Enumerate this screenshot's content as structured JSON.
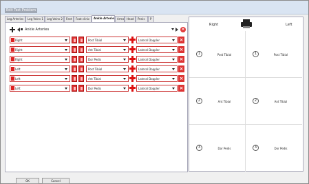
{
  "window": {
    "title": "Edit Test Problem"
  },
  "tabs": [
    {
      "label": "Leg Arteries",
      "active": false
    },
    {
      "label": "Leg Veins 1",
      "active": false
    },
    {
      "label": "Leg Veins 2",
      "active": false
    },
    {
      "label": "Feet",
      "active": false
    },
    {
      "label": "Foot clinic",
      "active": false
    },
    {
      "label": "Ankle Arteries",
      "active": true
    },
    {
      "label": "Arms",
      "active": false
    },
    {
      "label": "Head",
      "active": false
    },
    {
      "label": "Penis",
      "active": false
    },
    {
      "label": "P",
      "active": false
    }
  ],
  "artery_selector": {
    "value": "Ankle Arteries"
  },
  "rows": [
    {
      "side": "Right",
      "vessel": "Post Tibial",
      "method": "Lateral Doppler"
    },
    {
      "side": "Right",
      "vessel": "Ant Tibial",
      "method": "Lateral Doppler"
    },
    {
      "side": "Right",
      "vessel": "Dor Pedis",
      "method": "Lateral Doppler"
    },
    {
      "side": "Left",
      "vessel": "Post Tibial",
      "method": "Lateral Doppler"
    },
    {
      "side": "Left",
      "vessel": "Ant Tibial",
      "method": "Lateral Doppler"
    },
    {
      "side": "Left",
      "vessel": "Dor Pedis",
      "method": "Lateral Doppler"
    }
  ],
  "diagram": {
    "right_label": "Right",
    "left_label": "Left",
    "cells": [
      {
        "num": "1",
        "label": "Post Tibial"
      },
      {
        "num": "1",
        "label": "Post Tibial"
      },
      {
        "num": "2",
        "label": "Ant Tibial"
      },
      {
        "num": "2",
        "label": "Ant Tibial"
      },
      {
        "num": "3",
        "label": "Dor Pedis"
      },
      {
        "num": "3",
        "label": "Dor Pedis"
      }
    ]
  },
  "buttons": {
    "ok": "OK",
    "cancel": "Cancel"
  },
  "icons": {
    "add": "add-icon",
    "back": "arrow-left-icon",
    "next": "arrow-right-icon",
    "close": "close-circle-icon",
    "print": "printer-icon",
    "delete": "delete-x-icon"
  },
  "colors": {
    "accent_red": "#d22222",
    "panel_border": "#aab"
  }
}
